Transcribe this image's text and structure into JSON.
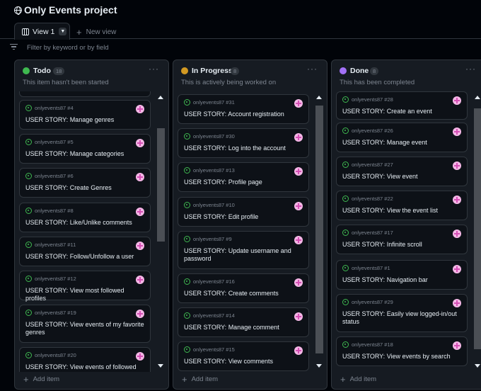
{
  "header": {
    "title": "Only Events project"
  },
  "tabs": {
    "active_label": "View 1",
    "new_view_label": "New view"
  },
  "filter": {
    "placeholder": "Filter by keyword or by field"
  },
  "columns": [
    {
      "title": "Todo",
      "count": "18",
      "description": "This item hasn't been started",
      "color": "#3fb950",
      "add_label": "Add item",
      "cards": [
        {
          "ref": "onlyevents87 #4",
          "title": "USER STORY: Manage genres"
        },
        {
          "ref": "onlyevents87 #5",
          "title": "USER STORY: Manage categories"
        },
        {
          "ref": "onlyevents87 #6",
          "title": "USER STORY: Create Genres"
        },
        {
          "ref": "onlyevents87 #8",
          "title": "USER STORY: Like/Unlike comments"
        },
        {
          "ref": "onlyevents87 #11",
          "title": "USER STORY: Follow/Unfollow a user"
        },
        {
          "ref": "onlyevents87 #12",
          "title": "USER STORY: View most followed profiles"
        },
        {
          "ref": "onlyevents87 #19",
          "title": "USER STORY: View events of my favorite genres"
        },
        {
          "ref": "onlyevents87 #20",
          "title": "USER STORY: View events of followed users"
        }
      ]
    },
    {
      "title": "In Progress",
      "count": "8",
      "description": "This is actively being worked on",
      "color": "#d29922",
      "add_label": "Add item",
      "cards": [
        {
          "ref": "onlyevents87 #31",
          "title": "USER STORY: Account registration"
        },
        {
          "ref": "onlyevents87 #30",
          "title": "USER STORY: Log into the account"
        },
        {
          "ref": "onlyevents87 #13",
          "title": "USER STORY: Profile page"
        },
        {
          "ref": "onlyevents87 #10",
          "title": "USER STORY: Edit profile"
        },
        {
          "ref": "onlyevents87 #9",
          "title": "USER STORY: Update username and password"
        },
        {
          "ref": "onlyevents87 #16",
          "title": "USER STORY: Create comments"
        },
        {
          "ref": "onlyevents87 #14",
          "title": "USER STORY: Manage comment"
        },
        {
          "ref": "onlyevents87 #15",
          "title": "USER STORY: View comments"
        }
      ]
    },
    {
      "title": "Done",
      "count": "8",
      "description": "This has been completed",
      "color": "#a371f7",
      "add_label": "Add item",
      "cards": [
        {
          "ref": "onlyevents87 #28",
          "title": "USER STORY: Create an event"
        },
        {
          "ref": "onlyevents87 #26",
          "title": "USER STORY: Manage event"
        },
        {
          "ref": "onlyevents87 #27",
          "title": "USER STORY: View event"
        },
        {
          "ref": "onlyevents87 #22",
          "title": "USER STORY: View the event list"
        },
        {
          "ref": "onlyevents87 #17",
          "title": "USER STORY: Infinite scroll"
        },
        {
          "ref": "onlyevents87 #1",
          "title": "USER STORY: Navigation bar"
        },
        {
          "ref": "onlyevents87 #29",
          "title": "USER STORY: Easily view logged-in/out status"
        },
        {
          "ref": "onlyevents87 #18",
          "title": "USER STORY: View events by search"
        }
      ]
    }
  ]
}
